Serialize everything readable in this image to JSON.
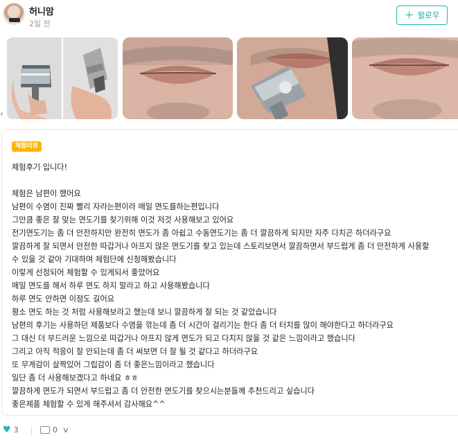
{
  "author": {
    "name": "허니맘",
    "posted": "2일 전"
  },
  "follow": {
    "label": "팔로우",
    "icon": "plus-icon"
  },
  "photos": [
    "razor-photo",
    "lips-photo",
    "shaving-photo",
    "lips-closeup-photo"
  ],
  "review": {
    "badge": "체험리뷰",
    "lines": [
      "체험후기 입니다!",
      "",
      "체험은 남편이 했어요",
      "남편이 수염이 진짜 빨리 자라는편이라 매일 면도를하는편입니다",
      "그만큼 좋은 잘 맞는 면도기를 찾기위해 이것 저것 사용해보고 있어요",
      "전기면도기는 좀 더 안전하지만 완전히 면도가 좀 아쉽고 수동면도기는 좀 더 깔끔하게 되지만 자주 다치곤 하더라구요",
      "깔끔하게 잘 되면서 안전한 따갑거나 아프지 않은 면도기를 찾고 있는데 스토리보면서 깔끔하면서 부드럽게 좀 더 안전하게 사용할",
      "수 있을 것 같아 기대하며 체험단에 신청해봤습니다",
      "이렇게 선정되어 체험할 수 있게되서 좋았어요",
      "매일 면도를 해서 하루 면도 하지 말라고 하고 사용해봤습니다",
      "하루 면도 안하면 이정도 길어요",
      "평소 면도 하는 것 처럼 사용해보라고 했는데 보니 깔끔하게 잘 되는 것 같았습니다",
      "남편의 후기는 사용하던 제품보다 수염을 깎는데 좀 더 시간이 걸리기는 한다 좀 더 터치를 많이 해야한다고 하더라구요",
      "그 대신 더 부드러운 느낌으로 따갑거나 아프지 않게 면도가 되고 다치지 않을 것 같은 느낌이라고 했습니다",
      "그리고 아직 적응이 잘 안되는데 좀 더 써보면 더 잘 될 것 같다고 하더라구요",
      "또 무게감이 살짝있어 그립감이 좀 더 좋은느낌이라고 했습니다",
      "일단 좀 더 사용해보겠다고 하네요 ㅎㅎ",
      "깔끔하게 면도가 되면서 부드럽고 좀 더 안전한 면도기를 찾으시는분들께 추천드리고 싶습니다",
      "좋은제품 체험할 수 있게 해주셔서 감사해요^^"
    ]
  },
  "footer": {
    "likes": "3",
    "comments": "0",
    "like_icon": "heart-icon",
    "comment_icon": "comment-icon"
  },
  "colors": {
    "accent": "#19b8a8",
    "badge": "#ffb300",
    "heart": "#1fb6b8"
  }
}
